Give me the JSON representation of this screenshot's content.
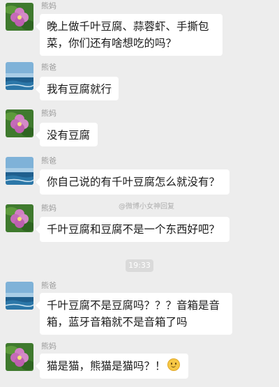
{
  "messages": [
    {
      "sender": "熊妈",
      "avatar": "flower-avatar",
      "text": "晚上做千叶豆腐、蒜蓉虾、手撕包菜，你们还有啥想吃的吗？"
    },
    {
      "sender": "熊爸",
      "avatar": "sea-avatar",
      "text": "我有豆腐就行"
    },
    {
      "sender": "熊妈",
      "avatar": "flower-avatar",
      "text": "没有豆腐"
    },
    {
      "sender": "熊爸",
      "avatar": "sea-avatar",
      "text": "你自己说的有千叶豆腐怎么就没有？"
    },
    {
      "sender": "熊妈",
      "avatar": "flower-avatar",
      "text": "千叶豆腐和豆腐不是一个东西好吧？"
    },
    {
      "sender": "熊爸",
      "avatar": "sea-avatar",
      "text": "千叶豆腐不是豆腐吗？？？音箱是音箱，蓝牙音箱就不是音箱了吗"
    },
    {
      "sender": "熊妈",
      "avatar": "flower-avatar",
      "text": "猫是猫，熊猫是猫吗？！",
      "emoji": "smile-emoji"
    }
  ],
  "timestamp": "19:33",
  "watermark": "@微博小女神回复",
  "colors": {
    "background": "#ededed",
    "bubble": "#ffffff",
    "sender_name": "#9a9a9a",
    "timestamp_pill": "#dadada"
  }
}
